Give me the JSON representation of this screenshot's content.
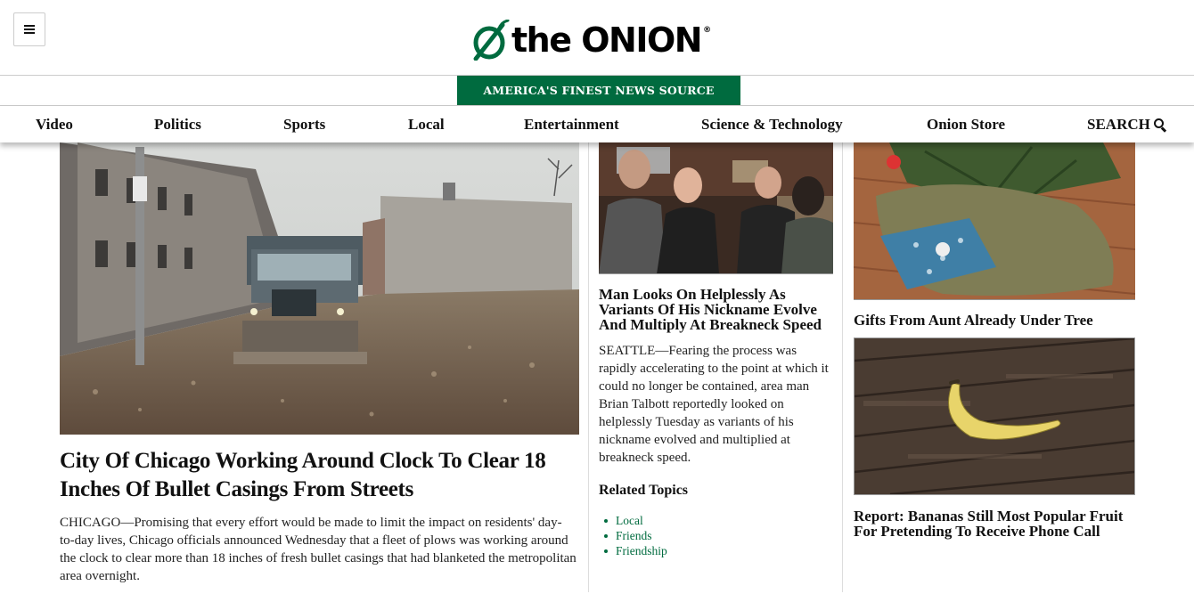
{
  "header": {
    "logo_text": "the ONION",
    "logo_mark": "®",
    "tagline": "AMERICA'S FINEST NEWS SOURCE"
  },
  "nav": {
    "items": [
      {
        "label": "Video"
      },
      {
        "label": "Politics"
      },
      {
        "label": "Sports"
      },
      {
        "label": "Local"
      },
      {
        "label": "Entertainment"
      },
      {
        "label": "Science & Technology"
      },
      {
        "label": "Onion Store"
      }
    ],
    "search_label": "SEARCH"
  },
  "lead_story": {
    "title": "City Of Chicago Working Around Clock To Clear 18 Inches Of Bullet Casings From Streets",
    "excerpt": "CHICAGO—Promising that every effort would be made to limit the impact on residents' day-to-day lives, Chicago officials announced Wednesday that a fleet of plows was working around the clock to clear more than 18 inches of fresh bullet casings that had blanketed the metropolitan area overnight."
  },
  "middle_story": {
    "title": "Man Looks On Helplessly As Variants Of His Nickname Evolve And Multiply At Breakneck Speed",
    "excerpt": "SEATTLE—Fearing the process was rapidly accelerating to the point at which it could no longer be contained, area man Brian Talbott reportedly looked on helplessly Tuesday as variants of his nickname evolved and multiplied at breakneck speed.",
    "related_heading": "Related Topics",
    "related": [
      "Local",
      "Friends",
      "Friendship"
    ]
  },
  "side_stories": [
    {
      "title": "Gifts From Aunt Already Under Tree"
    },
    {
      "title": "Report: Bananas Still Most Popular Fruit For Pretending To Receive Phone Call"
    }
  ],
  "colors": {
    "brand_green": "#006b3f",
    "text": "#111111"
  },
  "icons": {
    "menu": "hamburger-icon",
    "search": "search-icon",
    "logo": "onion-leaf-icon"
  }
}
